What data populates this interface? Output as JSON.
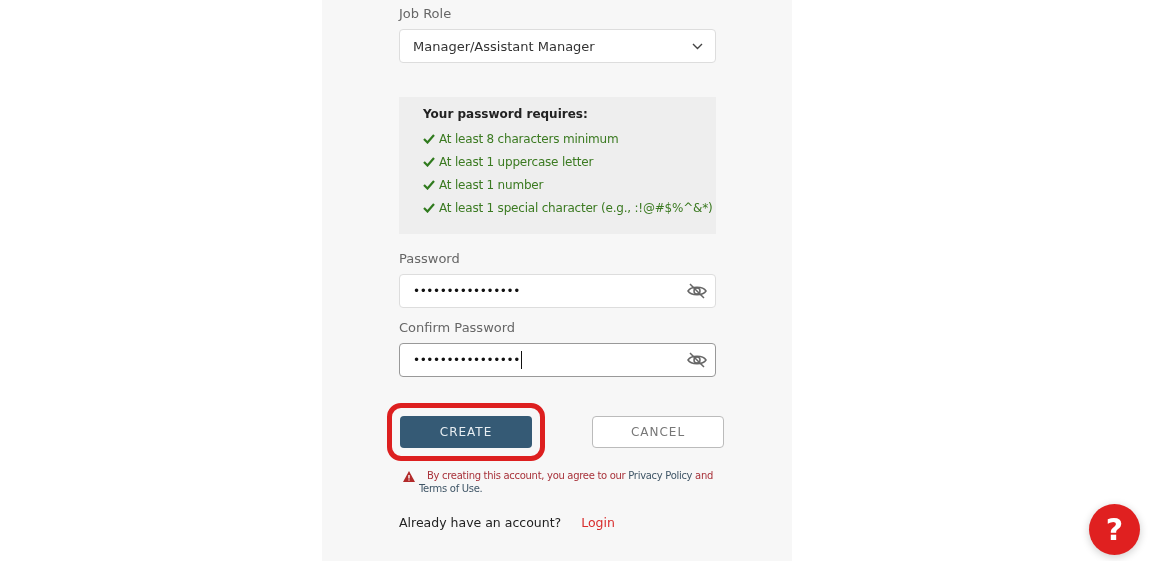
{
  "job_role": {
    "label": "Job Role",
    "value": "Manager/Assistant Manager"
  },
  "requirements": {
    "title": "Your password requires:",
    "items": [
      {
        "text": "At least 8 characters minimum",
        "met": true
      },
      {
        "text": "At least 1 uppercase letter",
        "met": true
      },
      {
        "text": "At least 1 number",
        "met": true
      },
      {
        "text": "At least 1 special character (e.g., :!@#$%^&*)",
        "met": true
      }
    ]
  },
  "fields": [
    {
      "label": "Password",
      "value": "••••••••••••••••",
      "focused": false
    },
    {
      "label": "Confirm Password",
      "value": "••••••••••••••••",
      "focused": true
    }
  ],
  "buttons": [
    {
      "label": "CREATE",
      "kind": "primary",
      "highlighted": true
    },
    {
      "label": "CANCEL",
      "kind": "secondary",
      "highlighted": false
    }
  ],
  "notice": {
    "text": "By creating this account, you agree to our",
    "privacy_link": "Privacy Policy",
    "and": "and",
    "terms_link": "Terms of Use."
  },
  "login_prompt": {
    "text": "Already have an account?",
    "link": "Login"
  },
  "help_button": {
    "label": "?"
  }
}
